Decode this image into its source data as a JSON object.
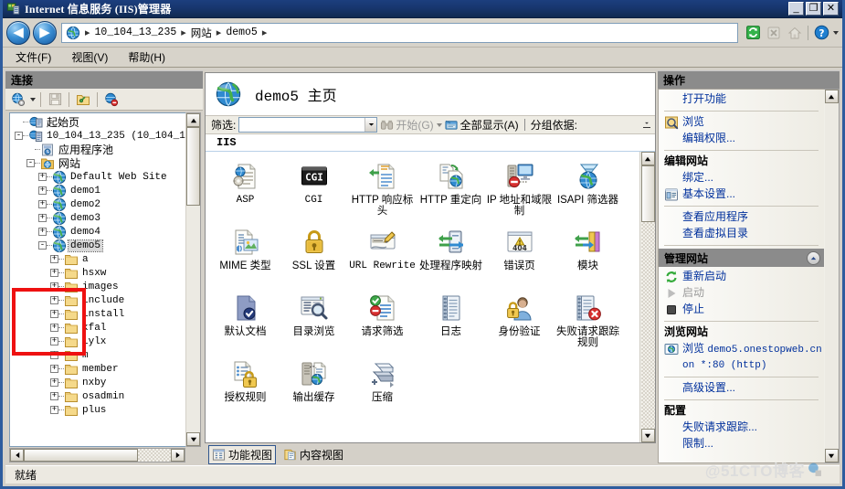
{
  "window": {
    "title": "Internet 信息服务 (IIS)管理器",
    "icon": "iis-manager-icon",
    "buttons": {
      "minimize": "_",
      "maximize": "❐",
      "close": "✕"
    }
  },
  "addressbar": {
    "back": "◀",
    "forward": "▶",
    "globe_icon": "globe-icon",
    "separator": "▸",
    "crumbs": [
      "10_104_13_235",
      "网站",
      "demo5"
    ],
    "tools": [
      "refresh-icon",
      "stop-icon",
      "home-icon",
      "help-icon",
      "help-dropdown-caret"
    ]
  },
  "menubar": {
    "items": [
      "文件(F)",
      "视图(V)",
      "帮助(H)"
    ]
  },
  "connections": {
    "header": "连接",
    "toolbar": [
      "connect-globe-icon",
      "toolbar-dropdown-caret",
      "save-icon",
      "connect-to-site-icon",
      "disconnect-icon"
    ],
    "tree": [
      {
        "label": "起始页",
        "expander": "",
        "icon": "start-page-icon",
        "indent": 0,
        "cjk": true,
        "selected": false
      },
      {
        "label": "10_104_13_235 (10_104_1:",
        "expander": "-",
        "icon": "server-icon",
        "indent": 0,
        "cjk": false,
        "selected": false
      },
      {
        "label": "应用程序池",
        "expander": "",
        "icon": "app-pools-icon",
        "indent": 1,
        "cjk": true,
        "selected": false
      },
      {
        "label": "网站",
        "expander": "-",
        "icon": "sites-folder-icon",
        "indent": 1,
        "cjk": true,
        "selected": false
      },
      {
        "label": "Default Web Site",
        "expander": "+",
        "icon": "site-icon",
        "indent": 2,
        "cjk": false,
        "selected": false
      },
      {
        "label": "demo1",
        "expander": "+",
        "icon": "site-icon",
        "indent": 2,
        "cjk": false,
        "selected": false
      },
      {
        "label": "demo2",
        "expander": "+",
        "icon": "site-icon",
        "indent": 2,
        "cjk": false,
        "selected": false
      },
      {
        "label": "demo3",
        "expander": "+",
        "icon": "site-icon",
        "indent": 2,
        "cjk": false,
        "selected": false
      },
      {
        "label": "demo4",
        "expander": "+",
        "icon": "site-icon",
        "indent": 2,
        "cjk": false,
        "selected": false
      },
      {
        "label": "demo5",
        "expander": "-",
        "icon": "site-icon",
        "indent": 2,
        "cjk": false,
        "selected": true
      },
      {
        "label": "a",
        "expander": "+",
        "icon": "folder-icon",
        "indent": 3,
        "cjk": false,
        "selected": false
      },
      {
        "label": "hsxw",
        "expander": "+",
        "icon": "folder-icon",
        "indent": 3,
        "cjk": false,
        "selected": false
      },
      {
        "label": "images",
        "expander": "+",
        "icon": "folder-icon",
        "indent": 3,
        "cjk": false,
        "selected": false
      },
      {
        "label": "include",
        "expander": "+",
        "icon": "folder-icon",
        "indent": 3,
        "cjk": false,
        "selected": false
      },
      {
        "label": "install",
        "expander": "+",
        "icon": "folder-icon",
        "indent": 3,
        "cjk": false,
        "selected": false
      },
      {
        "label": "kfal",
        "expander": "+",
        "icon": "folder-icon",
        "indent": 3,
        "cjk": false,
        "selected": false
      },
      {
        "label": "lylx",
        "expander": "+",
        "icon": "folder-icon",
        "indent": 3,
        "cjk": false,
        "selected": false
      },
      {
        "label": "m",
        "expander": "+",
        "icon": "folder-icon",
        "indent": 3,
        "cjk": false,
        "selected": false
      },
      {
        "label": "member",
        "expander": "+",
        "icon": "folder-icon",
        "indent": 3,
        "cjk": false,
        "selected": false
      },
      {
        "label": "nxby",
        "expander": "+",
        "icon": "folder-icon",
        "indent": 3,
        "cjk": false,
        "selected": false
      },
      {
        "label": "osadmin",
        "expander": "+",
        "icon": "folder-icon",
        "indent": 3,
        "cjk": false,
        "selected": false
      },
      {
        "label": "plus",
        "expander": "+",
        "icon": "folder-icon",
        "indent": 3,
        "cjk": false,
        "selected": false
      }
    ]
  },
  "main": {
    "page_title_site": "demo5",
    "page_title_suffix": "主页",
    "page_icon": "site-globe-icon",
    "filter": {
      "label": "筛选:",
      "value": "",
      "placeholder": "",
      "go_label": "开始(G)",
      "go_icon": "binoculars-icon",
      "showall_label": "全部显示(A)",
      "showall_icon": "show-all-icon",
      "groupby_label": "分组依据:",
      "overflow_icon": "overflow-chevron-icon"
    },
    "group_header": "IIS",
    "features": [
      {
        "label": "ASP",
        "icon": "asp-icon",
        "mono": true,
        "selected": false
      },
      {
        "label": "CGI",
        "icon": "cgi-icon",
        "mono": true,
        "selected": false
      },
      {
        "label": "HTTP 响应标头",
        "icon": "http-response-headers-icon",
        "mono": false,
        "selected": false
      },
      {
        "label": "HTTP 重定向",
        "icon": "http-redirect-icon",
        "mono": false,
        "selected": false
      },
      {
        "label": "IP 地址和域限制",
        "icon": "ip-domain-restrictions-icon",
        "mono": false,
        "selected": false
      },
      {
        "label": "ISAPI 筛选器",
        "icon": "isapi-filters-icon",
        "mono": false,
        "selected": false
      },
      {
        "label": "MIME 类型",
        "icon": "mime-types-icon",
        "mono": false,
        "selected": false
      },
      {
        "label": "SSL 设置",
        "icon": "ssl-settings-icon",
        "mono": false,
        "selected": false
      },
      {
        "label": "URL Rewrite",
        "icon": "url-rewrite-icon",
        "mono": true,
        "selected": false
      },
      {
        "label": "处理程序映射",
        "icon": "handler-mappings-icon",
        "mono": false,
        "selected": false
      },
      {
        "label": "错误页",
        "icon": "error-pages-icon",
        "mono": false,
        "selected": false
      },
      {
        "label": "模块",
        "icon": "modules-icon",
        "mono": false,
        "selected": false
      },
      {
        "label": "默认文档",
        "icon": "default-document-icon",
        "mono": false,
        "selected": true
      },
      {
        "label": "目录浏览",
        "icon": "directory-browsing-icon",
        "mono": false,
        "selected": false
      },
      {
        "label": "请求筛选",
        "icon": "request-filtering-icon",
        "mono": false,
        "selected": false
      },
      {
        "label": "日志",
        "icon": "logging-icon",
        "mono": false,
        "selected": false
      },
      {
        "label": "身份验证",
        "icon": "authentication-icon",
        "mono": false,
        "selected": false
      },
      {
        "label": "失败请求跟踪规则",
        "icon": "failed-request-tracing-rules-icon",
        "mono": false,
        "selected": false
      },
      {
        "label": "授权规则",
        "icon": "authorization-rules-icon",
        "mono": false,
        "selected": false
      },
      {
        "label": "输出缓存",
        "icon": "output-caching-icon",
        "mono": false,
        "selected": false
      },
      {
        "label": "压缩",
        "icon": "compression-icon",
        "mono": false,
        "selected": false
      }
    ],
    "view_tabs": [
      {
        "label": "功能视图",
        "icon": "features-view-icon",
        "active": true
      },
      {
        "label": "内容视图",
        "icon": "content-view-icon",
        "active": false
      }
    ]
  },
  "actions": {
    "header": "操作",
    "items": [
      {
        "type": "link",
        "label": "打开功能",
        "icon": "",
        "indent": true
      },
      {
        "type": "sep"
      },
      {
        "type": "link",
        "label": "浏览",
        "icon": "browse-icon",
        "indent": false
      },
      {
        "type": "link",
        "label": "编辑权限...",
        "icon": "",
        "indent": true
      },
      {
        "type": "sep"
      },
      {
        "type": "head",
        "label": "编辑网站"
      },
      {
        "type": "link",
        "label": "绑定...",
        "icon": "",
        "indent": true
      },
      {
        "type": "link",
        "label": "基本设置...",
        "icon": "basic-settings-icon",
        "indent": false
      },
      {
        "type": "sep"
      },
      {
        "type": "link",
        "label": "查看应用程序",
        "icon": "",
        "indent": true
      },
      {
        "type": "link",
        "label": "查看虚拟目录",
        "icon": "",
        "indent": true
      },
      {
        "type": "sep"
      },
      {
        "type": "section",
        "label": "管理网站",
        "collapse_icon": "chevron-up-icon"
      },
      {
        "type": "link",
        "label": "重新启动",
        "icon": "restart-icon",
        "indent": false
      },
      {
        "type": "disabled",
        "label": "启动",
        "icon": "start-icon",
        "indent": false
      },
      {
        "type": "link",
        "label": "停止",
        "icon": "stop-square-icon",
        "indent": false
      },
      {
        "type": "sep"
      },
      {
        "type": "head",
        "label": "浏览网站"
      },
      {
        "type": "browse",
        "label": "浏览",
        "detail": "demo5.onestopweb.cn on *:80 (http)",
        "icon": "browse-site-icon"
      },
      {
        "type": "sep"
      },
      {
        "type": "link",
        "label": "高级设置...",
        "icon": "",
        "indent": true
      },
      {
        "type": "sep"
      },
      {
        "type": "head",
        "label": "配置"
      },
      {
        "type": "link",
        "label": "失败请求跟踪...",
        "icon": "",
        "indent": true
      },
      {
        "type": "link",
        "label": "限制...",
        "icon": "",
        "indent": true
      }
    ]
  },
  "statusbar": {
    "text": "就绪"
  },
  "watermark": {
    "text": "@51CTO博客",
    "icon": "watermark-icon"
  },
  "annotation": {
    "target": "默认文档",
    "color": "#ee1111"
  },
  "colors": {
    "title_bar": "#17356c",
    "panel_header": "#8b8b8b",
    "link_text": "#00309c",
    "selection": "#0a246a",
    "window_bg": "#d4d0c8",
    "annotation_red": "#ee1111"
  }
}
